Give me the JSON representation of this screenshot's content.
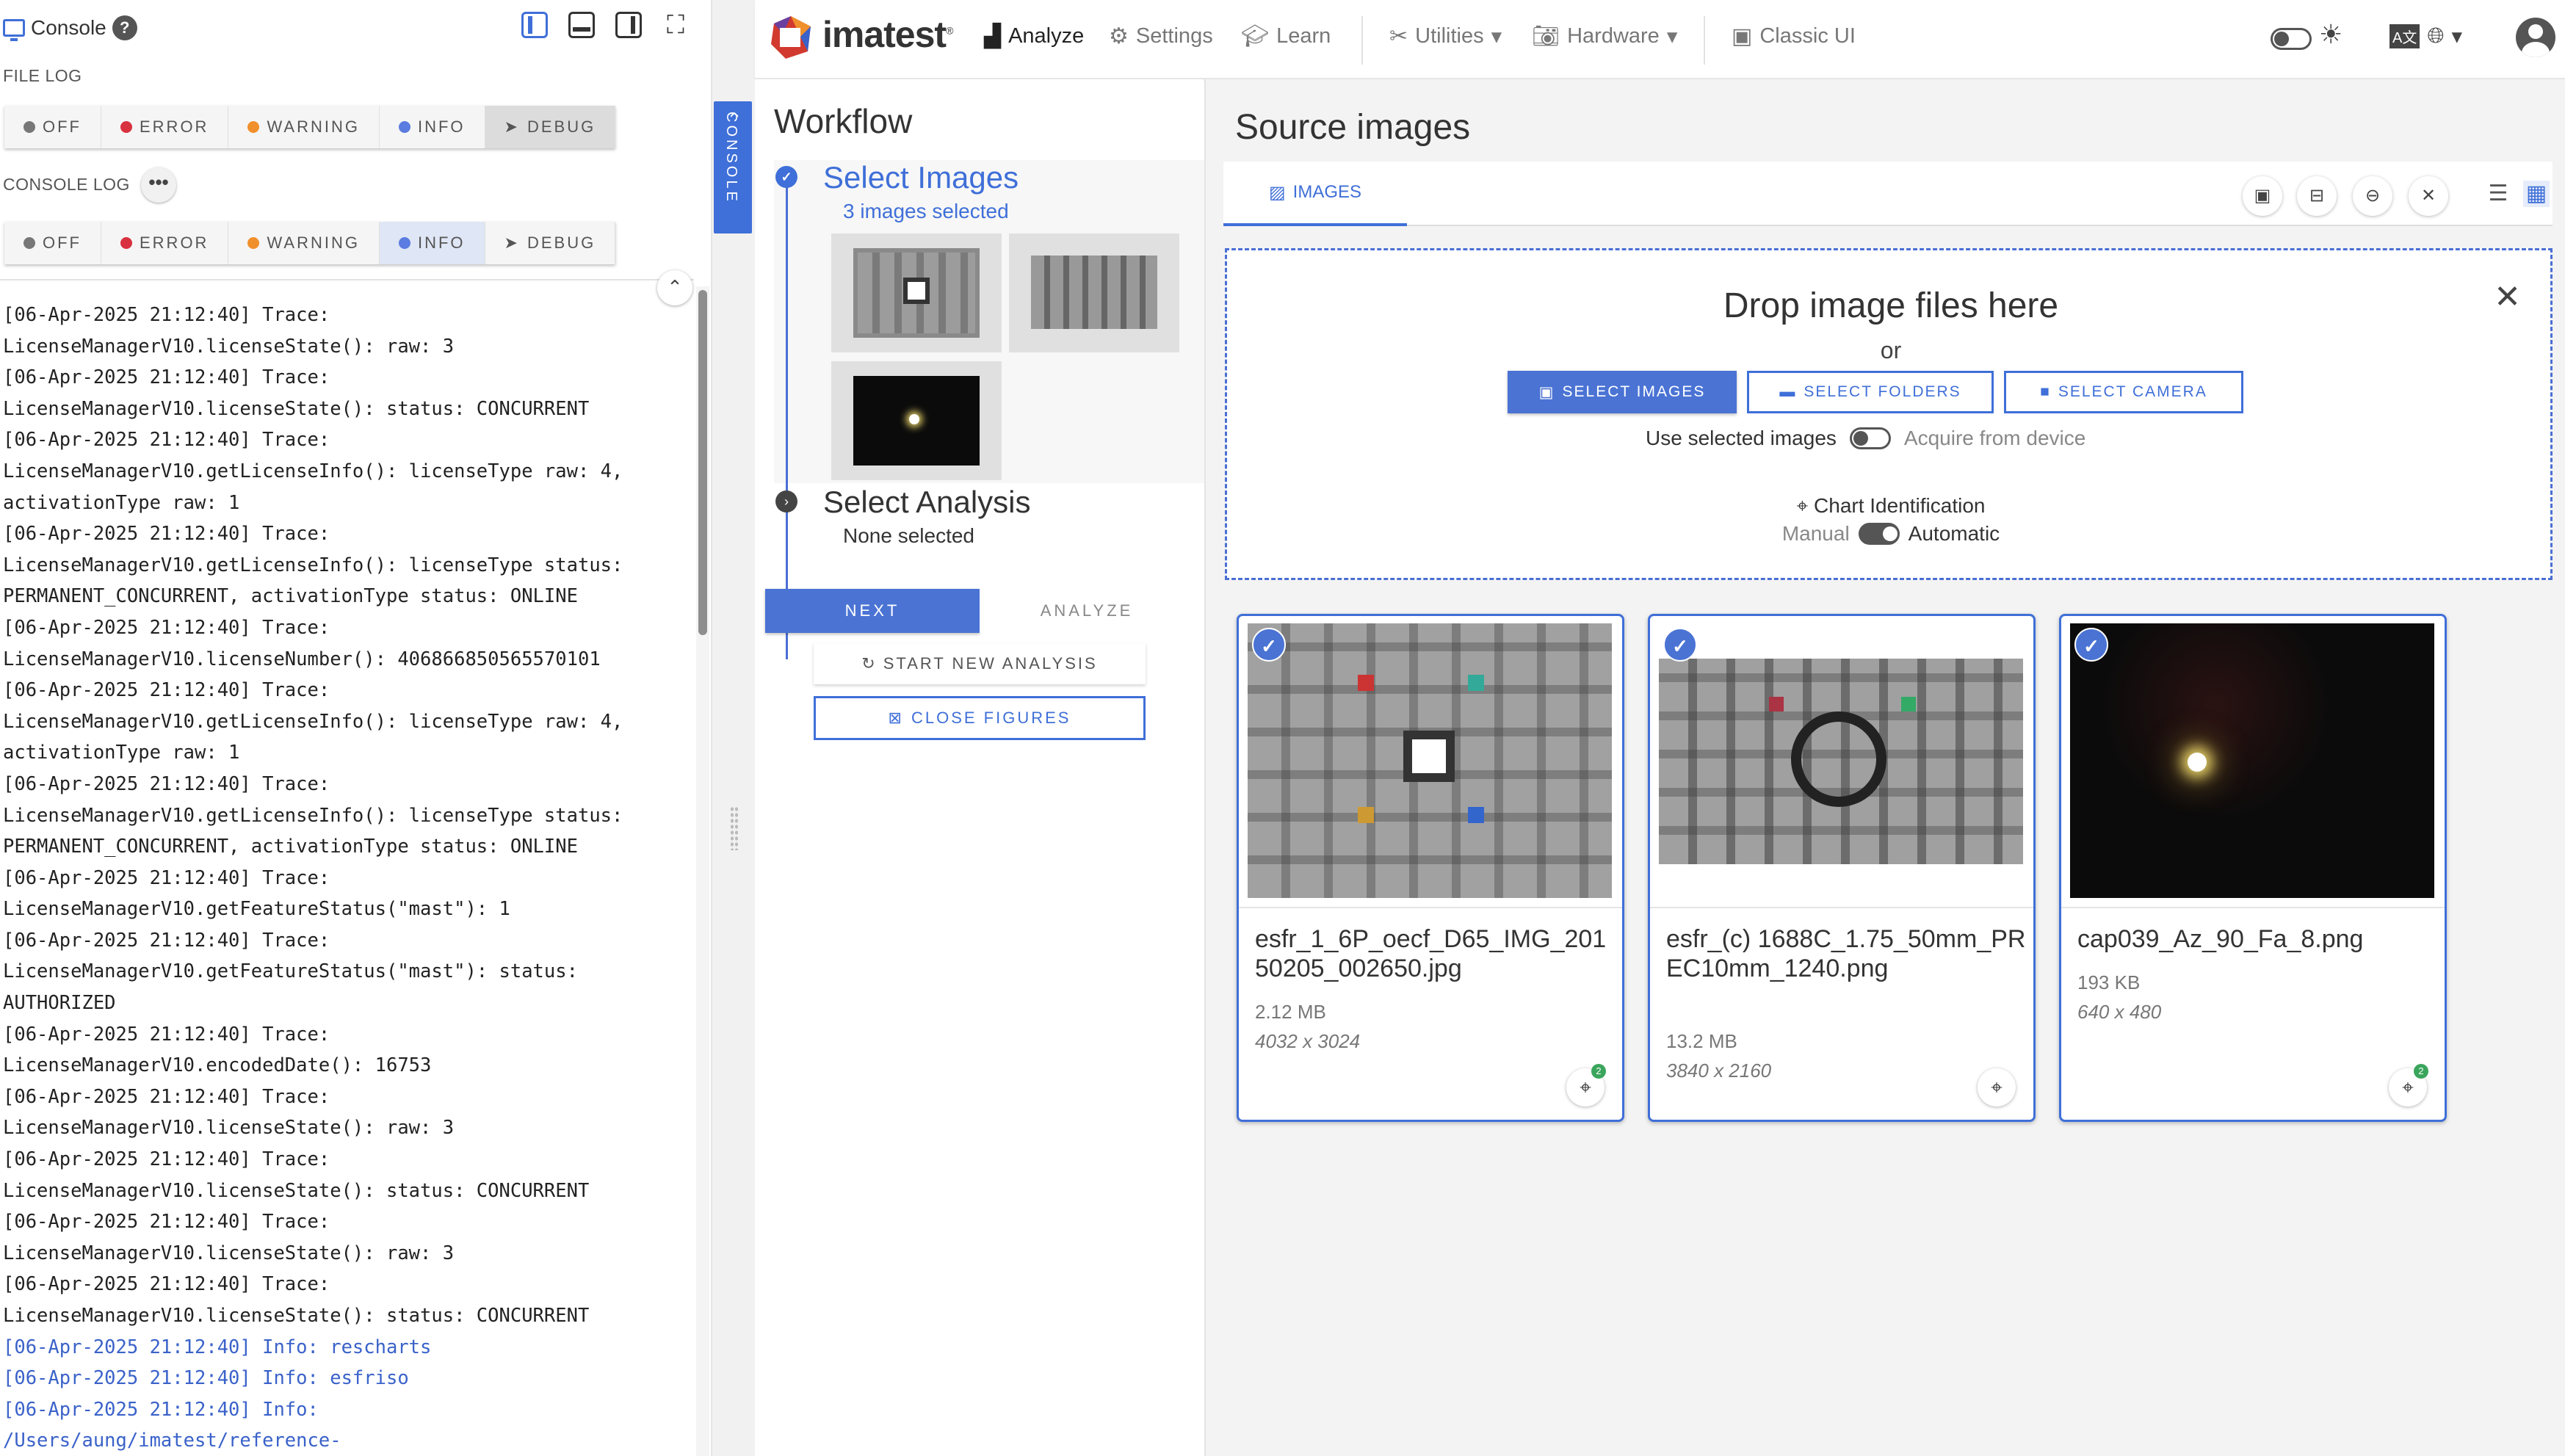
{
  "console": {
    "title": "Console",
    "file_log_label": "FILE LOG",
    "console_log_label": "CONSOLE LOG",
    "levels": [
      "OFF",
      "ERROR",
      "WARNING",
      "INFO",
      "DEBUG"
    ],
    "file_log_selected": "DEBUG",
    "console_log_selected": "INFO",
    "more": "•••",
    "log_lines": [
      {
        "text": "[06-Apr-2025 21:12:40] Trace:",
        "kind": "trace"
      },
      {
        "text": "LicenseManagerV10.licenseState(): raw: 3",
        "kind": "trace"
      },
      {
        "text": "[06-Apr-2025 21:12:40] Trace:",
        "kind": "trace"
      },
      {
        "text": "LicenseManagerV10.licenseState(): status: CONCURRENT",
        "kind": "trace"
      },
      {
        "text": "[06-Apr-2025 21:12:40] Trace:",
        "kind": "trace"
      },
      {
        "text": "LicenseManagerV10.getLicenseInfo(): licenseType raw: 4,",
        "kind": "trace"
      },
      {
        "text": "activationType raw: 1",
        "kind": "trace"
      },
      {
        "text": "[06-Apr-2025 21:12:40] Trace:",
        "kind": "trace"
      },
      {
        "text": "LicenseManagerV10.getLicenseInfo(): licenseType status:",
        "kind": "trace"
      },
      {
        "text": "PERMANENT_CONCURRENT, activationType status: ONLINE",
        "kind": "trace"
      },
      {
        "text": "[06-Apr-2025 21:12:40] Trace:",
        "kind": "trace"
      },
      {
        "text": "LicenseManagerV10.licenseNumber(): 406866850565570101",
        "kind": "trace"
      },
      {
        "text": "[06-Apr-2025 21:12:40] Trace:",
        "kind": "trace"
      },
      {
        "text": "LicenseManagerV10.getLicenseInfo(): licenseType raw: 4,",
        "kind": "trace"
      },
      {
        "text": "activationType raw: 1",
        "kind": "trace"
      },
      {
        "text": "[06-Apr-2025 21:12:40] Trace:",
        "kind": "trace"
      },
      {
        "text": "LicenseManagerV10.getLicenseInfo(): licenseType status:",
        "kind": "trace"
      },
      {
        "text": "PERMANENT_CONCURRENT, activationType status: ONLINE",
        "kind": "trace"
      },
      {
        "text": "[06-Apr-2025 21:12:40] Trace:",
        "kind": "trace"
      },
      {
        "text": "LicenseManagerV10.getFeatureStatus(\"mast\"): 1",
        "kind": "trace"
      },
      {
        "text": "[06-Apr-2025 21:12:40] Trace:",
        "kind": "trace"
      },
      {
        "text": "LicenseManagerV10.getFeatureStatus(\"mast\"): status:",
        "kind": "trace"
      },
      {
        "text": "AUTHORIZED",
        "kind": "trace"
      },
      {
        "text": "[06-Apr-2025 21:12:40] Trace:",
        "kind": "trace"
      },
      {
        "text": "LicenseManagerV10.encodedDate(): 16753",
        "kind": "trace"
      },
      {
        "text": "[06-Apr-2025 21:12:40] Trace:",
        "kind": "trace"
      },
      {
        "text": "LicenseManagerV10.licenseState(): raw: 3",
        "kind": "trace"
      },
      {
        "text": "[06-Apr-2025 21:12:40] Trace:",
        "kind": "trace"
      },
      {
        "text": "LicenseManagerV10.licenseState(): status: CONCURRENT",
        "kind": "trace"
      },
      {
        "text": "[06-Apr-2025 21:12:40] Trace:",
        "kind": "trace"
      },
      {
        "text": "LicenseManagerV10.licenseState(): raw: 3",
        "kind": "trace"
      },
      {
        "text": "[06-Apr-2025 21:12:40] Trace:",
        "kind": "trace"
      },
      {
        "text": "LicenseManagerV10.licenseState(): status: CONCURRENT",
        "kind": "trace"
      },
      {
        "text": "[06-Apr-2025 21:12:40] Info: rescharts",
        "kind": "info"
      },
      {
        "text": "[06-Apr-2025 21:12:40] Info: esfriso",
        "kind": "info"
      },
      {
        "text": "[06-Apr-2025 21:12:40] Info:",
        "kind": "info"
      },
      {
        "text": "/Users/aung/imatest/reference-",
        "kind": "info"
      }
    ],
    "side_tab": "CONSOLE"
  },
  "header": {
    "logo": "imatest",
    "logo_mark": "®",
    "nav": {
      "analyze": "Analyze",
      "settings": "Settings",
      "learn": "Learn",
      "utilities": "Utilities",
      "hardware": "Hardware",
      "classic": "Classic UI"
    },
    "lang_label": "A文"
  },
  "workflow": {
    "title": "Workflow",
    "step1_title": "Select Images",
    "step1_sub": "3 images selected",
    "step2_title": "Select Analysis",
    "step2_sub": "None selected",
    "next": "NEXT",
    "analyze": "ANALYZE",
    "start_new": "START NEW ANALYSIS",
    "close_figures": "CLOSE FIGURES"
  },
  "source": {
    "title": "Source images",
    "tab_images": "IMAGES",
    "drop_title": "Drop image files here",
    "or": "or",
    "select_images": "SELECT IMAGES",
    "select_folders": "SELECT FOLDERS",
    "select_camera": "SELECT CAMERA",
    "use_selected": "Use selected images",
    "acquire": "Acquire from device",
    "chart_id": "Chart Identification",
    "manual": "Manual",
    "automatic": "Automatic",
    "cards": [
      {
        "name": "esfr_1_6P_oecf_D65_IMG_20150205_002650.jpg",
        "size": "2.12 MB",
        "dims": "4032 x 3024",
        "badge": "2"
      },
      {
        "name": "esfr_(c) 1688C_1.75_50mm_PREC10mm_1240.png",
        "size": "13.2 MB",
        "dims": "3840 x 2160",
        "badge": ""
      },
      {
        "name": "cap039_Az_90_Fa_8.png",
        "size": "193 KB",
        "dims": "640 x 480",
        "badge": "2"
      }
    ]
  },
  "colors": {
    "accent": "#3f6fd8",
    "error": "#d8313f",
    "warning": "#f0902c",
    "info": "#5b7ce0",
    "off": "#777777"
  }
}
